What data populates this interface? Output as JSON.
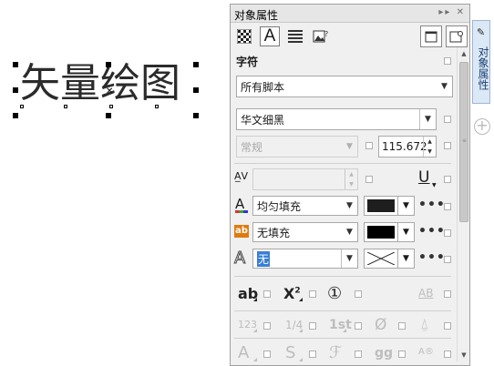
{
  "canvas": {
    "text": "矢量绘图"
  },
  "panel": {
    "title": "对象属性",
    "title_controls": "▸▸ ✕",
    "section": "字符",
    "script": "所有脚本",
    "font_name": "华文细黑",
    "font_style": "常规",
    "font_size": "115.672",
    "fill_type": "均匀填充",
    "fill_color": "#1e1e1e",
    "bg_fill_type": "无填充",
    "bg_fill_color": "#000000",
    "outline_width": "无",
    "features_row1": {
      "lowercase": "ab",
      "superscript": "X",
      "superscript_mark": "2",
      "circled": "①",
      "allcaps": "AB"
    },
    "features_row2": {
      "oldstyle": "123",
      "fraction": "1/4",
      "ordinal": "1st",
      "slashed_zero": "Ø",
      "contextual": "g",
      "ligature": "gg",
      "historical": "A®"
    }
  },
  "sidetab": {
    "label": "对象属性",
    "add": "+"
  },
  "scrollbar": {
    "up": "▲",
    "down": "▼",
    "grip": "≡"
  },
  "colors": {
    "accent": "#3a7fd5",
    "panel_bg": "#f0f0f0"
  }
}
